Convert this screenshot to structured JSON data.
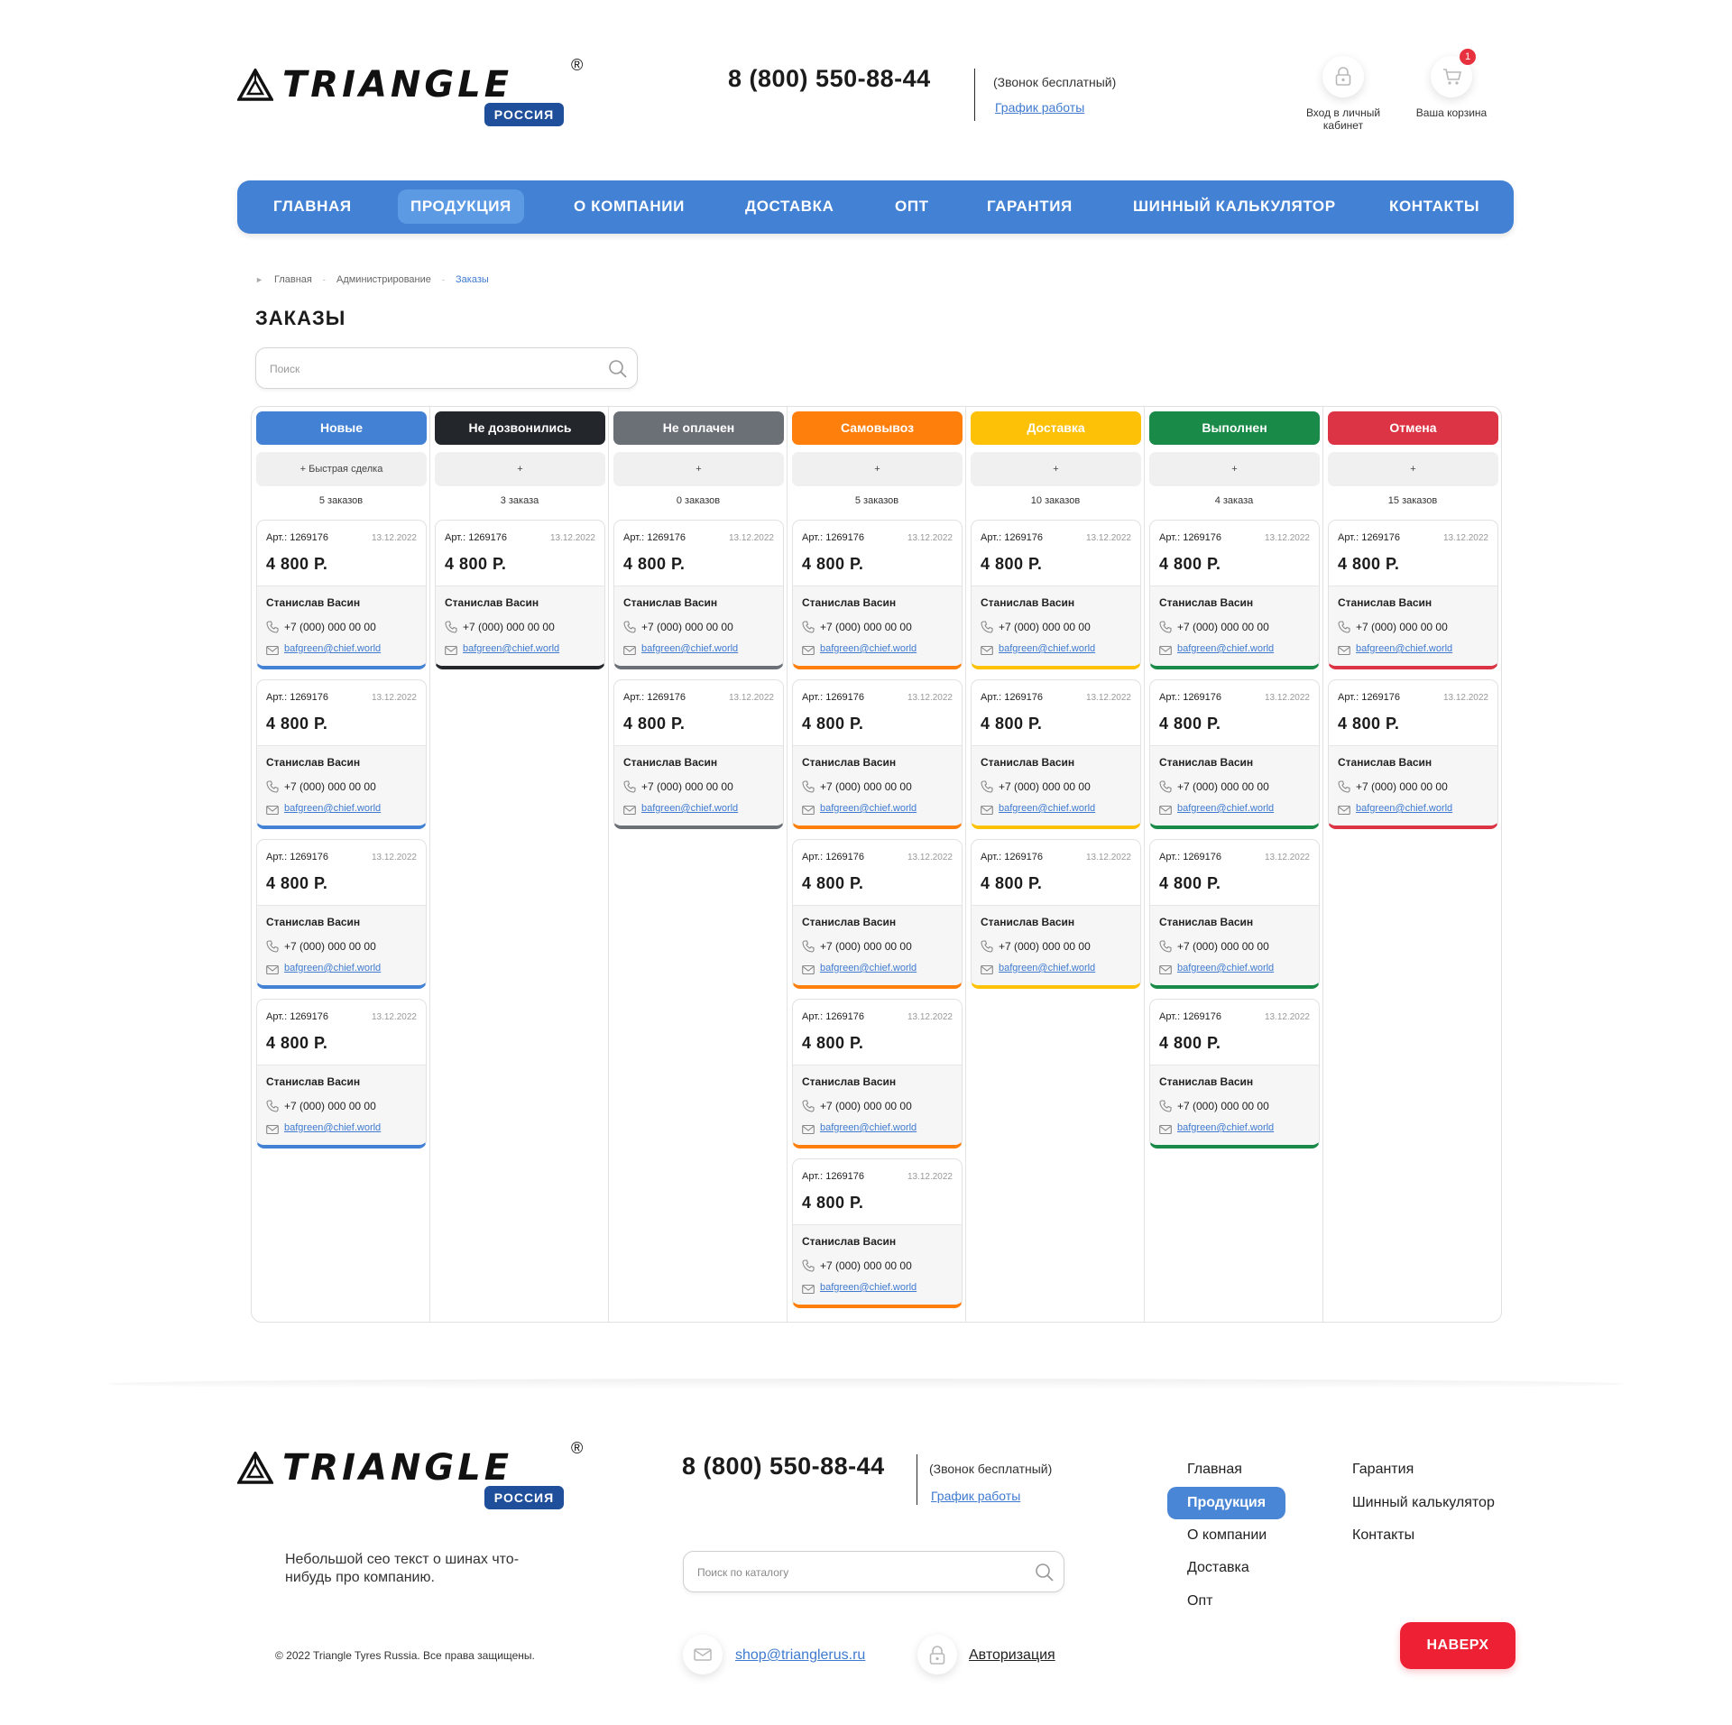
{
  "header": {
    "brand": "TRIANGLE",
    "brand_sub": "РОССИЯ",
    "phone": "8 (800) 550-88-44",
    "call_note": "(Звонок бесплатный)",
    "schedule_link": "График работы",
    "login_label": "Вход в личный кабинет",
    "cart_label": "Ваша корзина",
    "cart_count": "1"
  },
  "nav": {
    "items": [
      "ГЛАВНАЯ",
      "ПРОДУКЦИЯ",
      "О КОМПАНИИ",
      "ДОСТАВКА",
      "ОПТ",
      "ГАРАНТИЯ",
      "ШИННЫЙ КАЛЬКУЛЯТОР",
      "КОНТАКТЫ"
    ],
    "active": "ПРОДУКЦИЯ"
  },
  "breadcrumbs": [
    "Главная",
    "Администрирование",
    "Заказы"
  ],
  "page_title": "ЗАКАЗЫ",
  "search": {
    "placeholder": "Поиск"
  },
  "card_template": {
    "art": "Арт.: 1269176",
    "date": "13.12.2022",
    "price": "4 800 Р.",
    "name": "Станислав Васин",
    "phone": "+7 (000) 000 00 00",
    "email": "bafgreen@chief.world"
  },
  "columns": [
    {
      "title": "Новые",
      "color": "#4281d3",
      "add_label": "+ Быстрая сделка",
      "count_label": "5 заказов",
      "cards_shown": 4
    },
    {
      "title": "Не дозвонились",
      "color": "#23262b",
      "add_label": "+",
      "count_label": "3 заказа",
      "cards_shown": 1
    },
    {
      "title": "Не оплачен",
      "color": "#6b7077",
      "add_label": "+",
      "count_label": "0 заказов",
      "cards_shown": 2
    },
    {
      "title": "Самовывоз",
      "color": "#ff7f0c",
      "add_label": "+",
      "count_label": "5 заказов",
      "cards_shown": 5
    },
    {
      "title": "Доставка",
      "color": "#fdc107",
      "add_label": "+",
      "count_label": "10 заказов",
      "cards_shown": 3
    },
    {
      "title": "Выполнен",
      "color": "#1a8a48",
      "add_label": "+",
      "count_label": "4 заказа",
      "cards_shown": 4
    },
    {
      "title": "Отмена",
      "color": "#dc3444",
      "add_label": "+",
      "count_label": "15 заказов",
      "cards_shown": 2
    }
  ],
  "footer": {
    "brand": "TRIANGLE",
    "brand_sub": "РОССИЯ",
    "phone": "8 (800) 550-88-44",
    "call_note": "(Звонок бесплатный)",
    "schedule_link": "График работы",
    "seo_text": "Небольшой сео текст о шинах что-нибудь про компанию.",
    "copyright": "© 2022 Triangle Tyres Russia. Все права защищены.",
    "search_placeholder": "Поиск по каталогу",
    "email": "shop@trianglerus.ru",
    "auth_link": "Авторизация",
    "nav_col1": [
      "Главная",
      "Продукция",
      "О компании",
      "Доставка",
      "Опт"
    ],
    "nav_col2": [
      "Гарантия",
      "Шинный калькулятор",
      "Контакты"
    ],
    "nav_active": "Продукция",
    "up_button": "НАВЕРХ"
  },
  "colors": {
    "accent": "#4281d3",
    "link": "#3f7ad0",
    "up_button": "#ee2033"
  }
}
